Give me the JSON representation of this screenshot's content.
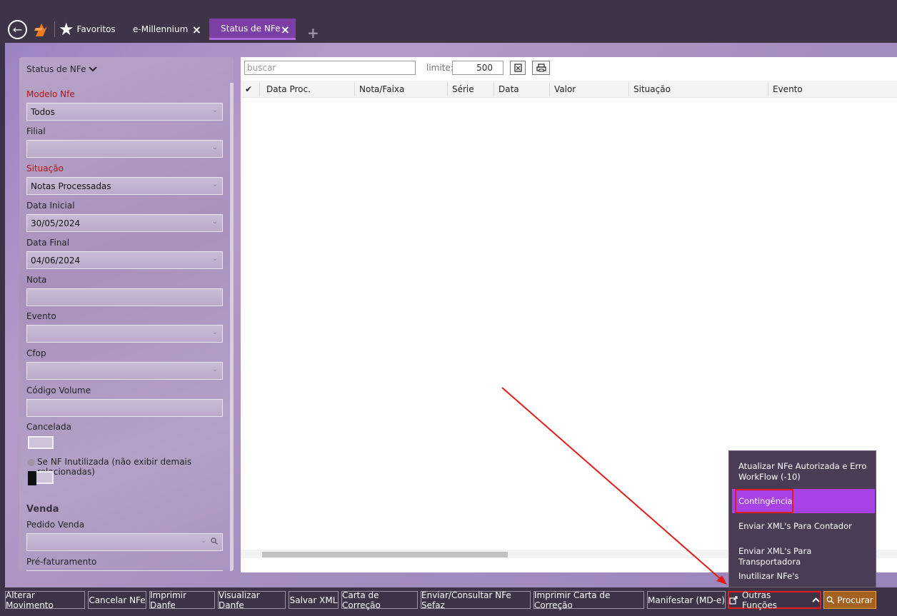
{
  "topbar": {
    "back_icon": "back-arrow-icon",
    "logo_icon": "millennium-logo-icon",
    "favorites_label": "Favoritos",
    "tabs": [
      {
        "label": "e-Millennium",
        "close": "×"
      },
      {
        "label": "Status de NFe",
        "close": "×"
      }
    ],
    "add_tab": "+"
  },
  "filters": {
    "header": "Status de NFe",
    "header_chevron": "⌄",
    "modelo_label": "Modelo Nfe",
    "modelo_value": "Todos",
    "filial_label": "Filial",
    "filial_value": "",
    "situacao_label": "Situação",
    "situacao_value": "Notas Processadas",
    "data_inicial_label": "Data Inicial",
    "data_inicial_value": "30/05/2024",
    "data_final_label": "Data Final",
    "data_final_value": "04/06/2024",
    "nota_label": "Nota",
    "nota_value": "",
    "evento_label": "Evento",
    "evento_value": "",
    "cfop_label": "Cfop",
    "cfop_value": "",
    "codigo_volume_label": "Código Volume",
    "codigo_volume_value": "",
    "cancelada_label": "Cancelada",
    "inutilizada_label": "Se NF Inutilizada (não exibir demais relacionadas)",
    "venda_title": "Venda",
    "pedido_venda_label": "Pedido Venda",
    "pedido_venda_value": "",
    "prefaturamento_label": "Pré-faturamento"
  },
  "grid": {
    "search_placeholder": "buscar",
    "limit_label": "limite:",
    "limit_value": "500",
    "export_icon": "export-excel-icon",
    "print_icon": "printer-icon",
    "check_header": "✔",
    "columns": [
      "Data Proc.",
      "Nota/Faixa",
      "Série",
      "Data",
      "Valor",
      "Situação",
      "Evento"
    ]
  },
  "toolbar": {
    "buttons": [
      "Alterar Movimento",
      "Cancelar NFe",
      "Imprimir Danfe",
      "Visualizar Danfe",
      "Salvar XML",
      "Carta de Correção",
      "Enviar/Consultar NFe Sefaz",
      "Imprimir Carta de Correção",
      "Manifestar (MD-e)"
    ],
    "outras_label": "Outras Funções",
    "outras_icon": "external-edit-icon",
    "procurar_label": "Procurar",
    "procurar_icon": "search-icon"
  },
  "menu": {
    "items": [
      "Atualizar NFe Autorizada e Erro WorkFlow (-10)",
      "Contingência",
      "Enviar XML's Para Contador",
      "Enviar XML's Para Transportadora",
      "Inutilizar NFe's"
    ],
    "active_index": 1
  },
  "colors": {
    "accent": "#7b3fa6",
    "menu_active": "#a743e6",
    "annotation_red": "#e21b1b",
    "procurar_bg": "#a4611f"
  }
}
